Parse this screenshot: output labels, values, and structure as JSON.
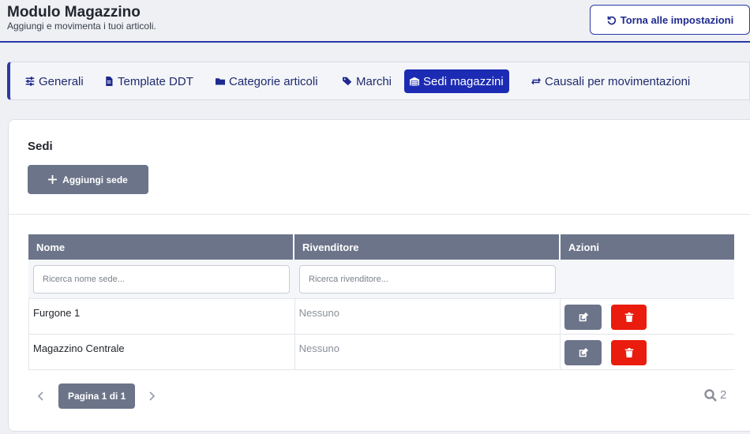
{
  "header": {
    "title": "Modulo Magazzino",
    "subtitle": "Aggiungi e movimenta i tuoi articoli.",
    "back_label": "Torna alle impostazioni"
  },
  "tabs": [
    {
      "label": "Generali",
      "icon": "sliders-icon"
    },
    {
      "label": "Template DDT",
      "icon": "file-icon"
    },
    {
      "label": "Categorie articoli",
      "icon": "folder-icon"
    },
    {
      "label": "Marchi",
      "icon": "tags-icon"
    },
    {
      "label": "Sedi magazzini",
      "icon": "warehouse-icon",
      "active": true
    },
    {
      "label": "Causali per movimentazioni",
      "icon": "exchange-icon"
    }
  ],
  "section": {
    "title": "Sedi",
    "add_label": "Aggiungi sede"
  },
  "table": {
    "columns": [
      "Nome",
      "Rivenditore",
      "Azioni"
    ],
    "filters": {
      "name_placeholder": "Ricerca nome sede...",
      "reseller_placeholder": "Ricerca rivenditore..."
    },
    "rows": [
      {
        "nome": "Furgone 1",
        "rivenditore": "Nessuno"
      },
      {
        "nome": "Magazzino Centrale",
        "rivenditore": "Nessuno"
      }
    ]
  },
  "pagination": {
    "label": "Pagina 1 di 1",
    "count": "2"
  },
  "colors": {
    "accent": "#1c2bb3",
    "muted_button": "#6c7489",
    "danger": "#ea1c0d"
  }
}
